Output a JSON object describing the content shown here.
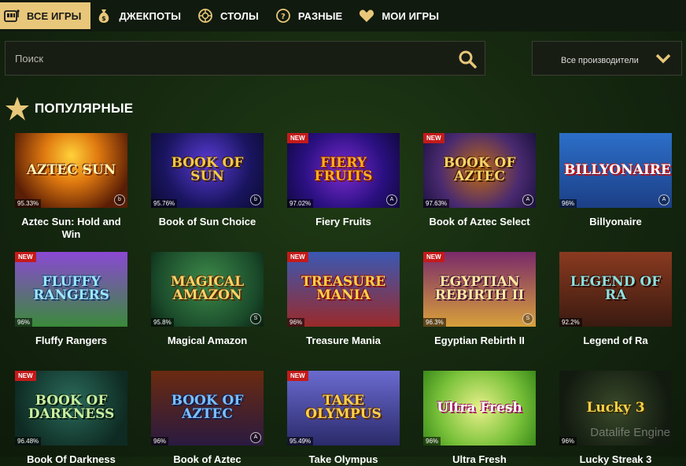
{
  "nav": {
    "items": [
      {
        "label": "ВСЕ ИГРЫ",
        "icon": "slot-machine-icon",
        "active": true
      },
      {
        "label": "ДЖЕКПОТЫ",
        "icon": "money-bag-icon",
        "active": false
      },
      {
        "label": "СТОЛЫ",
        "icon": "roulette-icon",
        "active": false
      },
      {
        "label": "РАЗНЫЕ",
        "icon": "dice-icon",
        "active": false
      },
      {
        "label": "МОИ ИГРЫ",
        "icon": "heart-icon",
        "active": false
      }
    ]
  },
  "search": {
    "placeholder": "Поиск",
    "value": ""
  },
  "provider_filter": {
    "label": "Все производители"
  },
  "section": {
    "title": "ПОПУЛЯРНЫЕ"
  },
  "colors": {
    "accent": "#e8c77a",
    "new_badge": "#c41a1a"
  },
  "games": [
    {
      "name": "Aztec Sun: Hold and Win",
      "logo": "AZTEC SUN",
      "rtp": "95.33%",
      "new": false,
      "prov": "b"
    },
    {
      "name": "Book of Sun Choice",
      "logo": "BOOK OF SUN",
      "rtp": "95.76%",
      "new": false,
      "prov": "b"
    },
    {
      "name": "Fiery Fruits",
      "logo": "FIERY FRUITS",
      "rtp": "97.02%",
      "new": true,
      "prov": "A"
    },
    {
      "name": "Book of Aztec Select",
      "logo": "BOOK OF AZTEC",
      "rtp": "97.63%",
      "new": true,
      "prov": "A"
    },
    {
      "name": "Billyonaire",
      "logo": "BILLYONAIRE",
      "rtp": "96%",
      "new": false,
      "prov": "A"
    },
    {
      "name": "Fluffy Rangers",
      "logo": "FLUFFY RANGERS",
      "rtp": "96%",
      "new": true,
      "prov": ""
    },
    {
      "name": "Magical Amazon",
      "logo": "MAGICAL AMAZON",
      "rtp": "95.8%",
      "new": false,
      "prov": "S"
    },
    {
      "name": "Treasure Mania",
      "logo": "TREASURE MANIA",
      "rtp": "96%",
      "new": true,
      "prov": ""
    },
    {
      "name": "Egyptian Rebirth II",
      "logo": "EGYPTIAN REBIRTH II",
      "rtp": "96.3%",
      "new": true,
      "prov": "S"
    },
    {
      "name": "Legend of Ra",
      "logo": "LEGEND OF RA",
      "rtp": "92.2%",
      "new": false,
      "prov": ""
    },
    {
      "name": "Book Of Darkness",
      "logo": "BOOK OF DARKNESS",
      "rtp": "96.48%",
      "new": true,
      "prov": ""
    },
    {
      "name": "Book of Aztec",
      "logo": "BOOK OF AZTEC",
      "rtp": "96%",
      "new": false,
      "prov": "A"
    },
    {
      "name": "Take Olympus",
      "logo": "TAKE OLYMPUS",
      "rtp": "95.49%",
      "new": true,
      "prov": ""
    },
    {
      "name": "Ultra Fresh",
      "logo": "Ultra Fresh",
      "rtp": "96%",
      "new": false,
      "prov": ""
    },
    {
      "name": "Lucky Streak 3",
      "logo": "Lucky 3",
      "rtp": "96%",
      "new": false,
      "prov": ""
    }
  ],
  "watermark": "Datalife Engine"
}
